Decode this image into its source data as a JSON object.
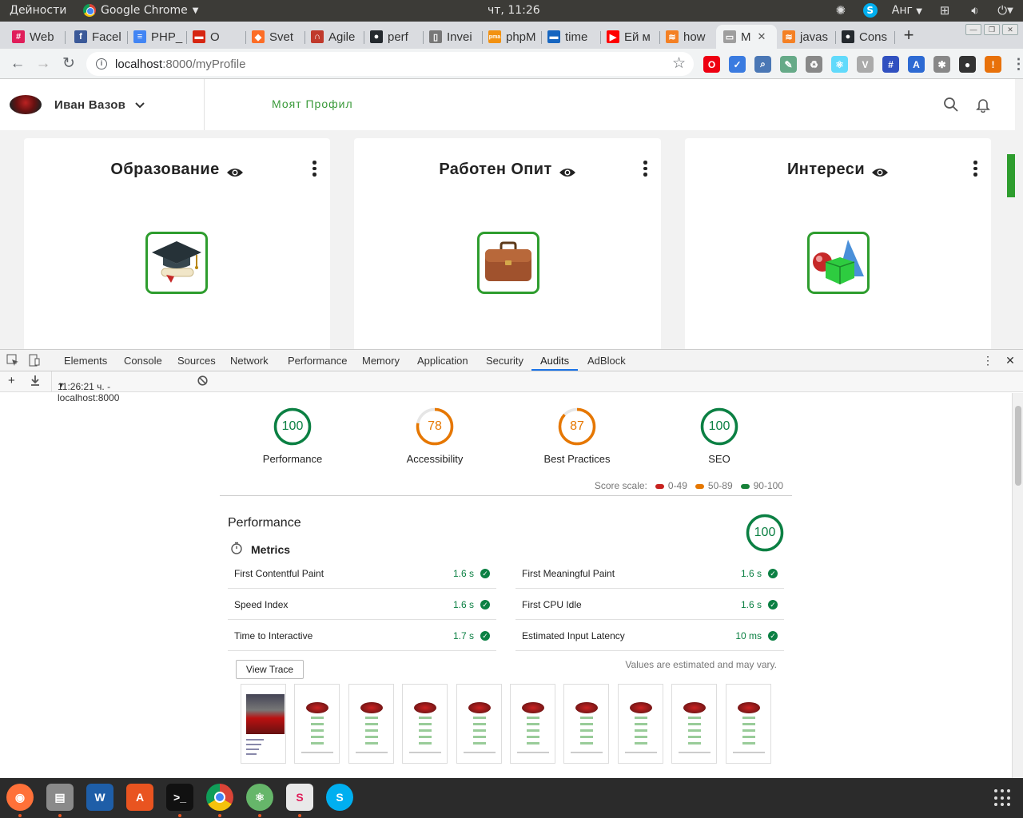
{
  "os": {
    "activities": "Дейности",
    "app_name": "Google Chrome",
    "clock": "чт, 11:26",
    "keyboard": "Анг",
    "tray_icons": [
      "puzzle-icon",
      "skype-icon",
      "network-icon",
      "volume-icon",
      "power-icon"
    ]
  },
  "tabs": [
    {
      "label": "Web",
      "icon": "slack-icon",
      "color": "#e01e5a"
    },
    {
      "label": "Facel",
      "icon": "facebook-icon",
      "color": "#3b5998"
    },
    {
      "label": "PHP_",
      "icon": "docs-icon",
      "color": "#4285f4"
    },
    {
      "label": "O",
      "icon": "flag-icon",
      "color": "#d62612"
    },
    {
      "label": "Svet",
      "icon": "gitlab-icon",
      "color": "#fc6d26"
    },
    {
      "label": "Agile",
      "icon": "scrum-icon",
      "color": "#c0392b"
    },
    {
      "label": "perf",
      "icon": "github-icon",
      "color": "#24292e"
    },
    {
      "label": "Invei",
      "icon": "file-icon",
      "color": "#777777"
    },
    {
      "label": "phpM",
      "icon": "phpmyadmin-icon",
      "color": "#f29111"
    },
    {
      "label": "time",
      "icon": "flag-icon",
      "color": "#1565c0"
    },
    {
      "label": "Ей м",
      "icon": "youtube-icon",
      "color": "#ff0000"
    },
    {
      "label": "how",
      "icon": "stackoverflow-icon",
      "color": "#f48024"
    },
    {
      "label": "M",
      "icon": "page-icon",
      "color": "#9e9e9e",
      "active": true
    },
    {
      "label": "javas",
      "icon": "stackoverflow-icon",
      "color": "#f48024"
    },
    {
      "label": "Cons",
      "icon": "github-icon",
      "color": "#24292e"
    }
  ],
  "toolbar": {
    "url_host": "localhost",
    "url_path": ":8000/myProfile"
  },
  "extensions": [
    {
      "icon": "opera-icon",
      "color": "#e01"
    },
    {
      "icon": "check-icon",
      "color": "#3a7be0"
    },
    {
      "icon": "magnifier-icon",
      "color": "#4a77b5"
    },
    {
      "icon": "pen-icon",
      "color": "#6a8"
    },
    {
      "icon": "recycle-icon",
      "color": "#888"
    },
    {
      "icon": "react-icon",
      "color": "#61dafb"
    },
    {
      "icon": "vue-icon",
      "color": "#aaa"
    },
    {
      "icon": "frame-icon",
      "color": "#3050c0"
    },
    {
      "icon": "a-icon",
      "color": "#2d6ad3"
    },
    {
      "icon": "bug-icon",
      "color": "#888"
    },
    {
      "icon": "user-icon",
      "color": "#333"
    },
    {
      "icon": "warning-icon",
      "color": "#e8710a"
    },
    {
      "icon": "menu-icon",
      "color": "#5f6368"
    }
  ],
  "page": {
    "user_name": "Иван Вазов",
    "header_link": "Моят Профил",
    "cards": [
      {
        "title": "Образование",
        "icon": "graduation-cap-icon"
      },
      {
        "title": "Работен Опит",
        "icon": "briefcase-icon"
      },
      {
        "title": "Интереси",
        "icon": "shapes-icon"
      }
    ]
  },
  "devtools": {
    "tabs": [
      "Elements",
      "Console",
      "Sources",
      "Network",
      "Performance",
      "Memory",
      "Application",
      "Security",
      "Audits",
      "AdBlock"
    ],
    "active_tab": "Audits",
    "report_label": "11:26:21 ч. - localhost:8000",
    "scores": [
      {
        "label": "Performance",
        "value": "100",
        "fraction": 1.0,
        "color": "#0b8043"
      },
      {
        "label": "Accessibility",
        "value": "78",
        "fraction": 0.78,
        "color": "#e67700"
      },
      {
        "label": "Best Practices",
        "value": "87",
        "fraction": 0.87,
        "color": "#e67700"
      },
      {
        "label": "SEO",
        "value": "100",
        "fraction": 1.0,
        "color": "#0b8043"
      }
    ],
    "score_scale": {
      "label": "Score scale:",
      "ranges": [
        {
          "range": "0-49",
          "color": "#c7221f"
        },
        {
          "range": "50-89",
          "color": "#e67700"
        },
        {
          "range": "90-100",
          "color": "#178239"
        }
      ]
    },
    "performance": {
      "title": "Performance",
      "score": "100",
      "metrics_title": "Metrics",
      "metrics": [
        {
          "name": "First Contentful Paint",
          "value": "1.6 s"
        },
        {
          "name": "First Meaningful Paint",
          "value": "1.6 s"
        },
        {
          "name": "Speed Index",
          "value": "1.6 s"
        },
        {
          "name": "First CPU Idle",
          "value": "1.6 s"
        },
        {
          "name": "Time to Interactive",
          "value": "1.7 s"
        },
        {
          "name": "Estimated Input Latency",
          "value": "10 ms"
        }
      ],
      "view_trace": "View Trace",
      "estimated_note": "Values are estimated and may vary."
    }
  },
  "dock": [
    {
      "icon": "firefox-icon",
      "color": "#ff7139"
    },
    {
      "icon": "files-icon",
      "color": "#8a8a8a"
    },
    {
      "icon": "writer-icon",
      "color": "#1e5ea8"
    },
    {
      "icon": "software-center-icon",
      "color": "#e95420"
    },
    {
      "icon": "terminal-icon",
      "color": "#111111"
    },
    {
      "icon": "chrome-icon",
      "color": "#4285f4",
      "active": true
    },
    {
      "icon": "atom-icon",
      "color": "#66b66a"
    },
    {
      "icon": "slack-icon",
      "color": "#e9e9e9"
    },
    {
      "icon": "skype-icon",
      "color": "#00aff0"
    }
  ]
}
